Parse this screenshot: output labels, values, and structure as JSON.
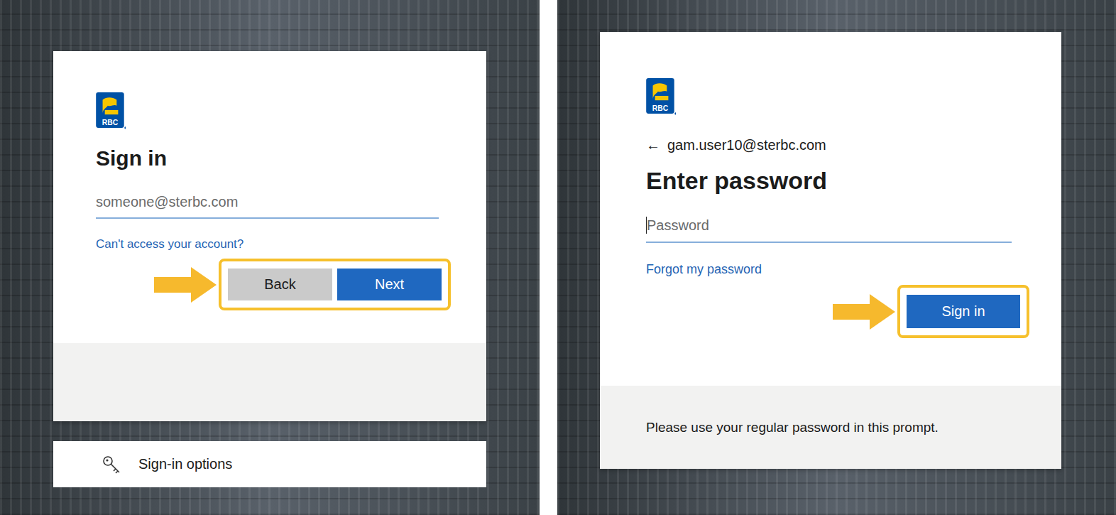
{
  "left": {
    "logo": "RBC",
    "title": "Sign in",
    "field": {
      "placeholder": "someone@sterbc.com"
    },
    "link": "Can't access your account?",
    "actions": {
      "highlighted": true,
      "buttons": [
        {
          "label": "Back",
          "kind": "secondary"
        },
        {
          "label": "Next",
          "kind": "primary"
        }
      ]
    },
    "options": {
      "label": "Sign-in options"
    }
  },
  "right": {
    "logo": "RBC",
    "back": "←",
    "account": "gam.user10@sterbc.com",
    "title": "Enter password",
    "field": {
      "placeholder": "Password"
    },
    "link": "Forgot my password",
    "actions": {
      "highlighted": true,
      "buttons": [
        {
          "label": "Sign in",
          "kind": "primary"
        }
      ]
    },
    "footer": "Please use your regular password in this prompt."
  }
}
